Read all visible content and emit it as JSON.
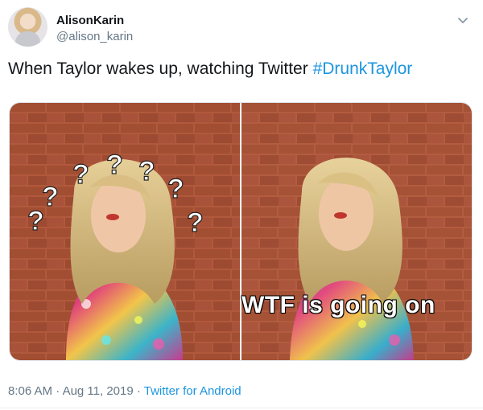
{
  "tweet": {
    "display_name": "AlisonKarin",
    "handle": "@alison_karin",
    "text": "When Taylor wakes up, watching Twitter ",
    "hashtag": "#DrunkTaylor",
    "time": "8:06 AM",
    "separator": " · ",
    "date": "Aug 11, 2019",
    "source": "Twitter for Android"
  },
  "media": {
    "right_caption": "WTF is going on",
    "question_mark": "?"
  },
  "icons": {
    "avatar": "avatar",
    "menu": "chevron-down-icon"
  },
  "colors": {
    "link": "#1b95e0",
    "secondary_text": "#657786",
    "primary_text": "#14171a"
  }
}
